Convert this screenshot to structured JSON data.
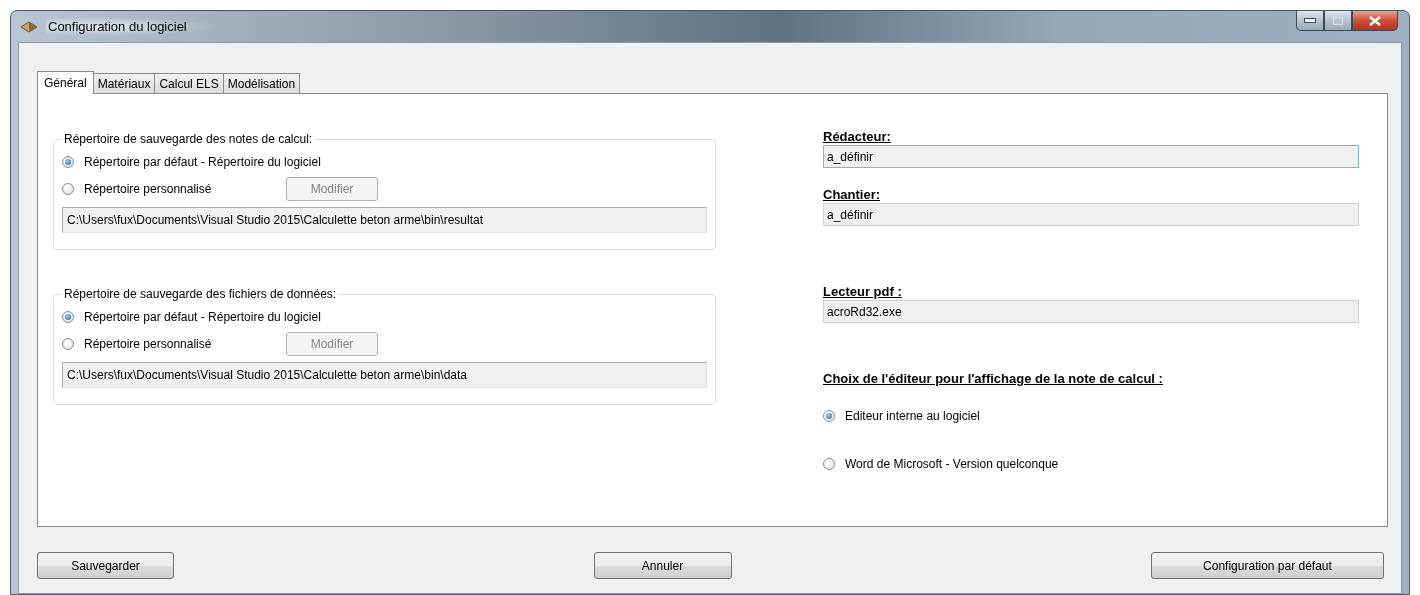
{
  "window": {
    "title": "Configuration du logiciel"
  },
  "tabs": [
    {
      "label": "Général",
      "selected": true
    },
    {
      "label": "Matériaux",
      "selected": false
    },
    {
      "label": "Calcul ELS",
      "selected": false
    },
    {
      "label": "Modélisation",
      "selected": false
    }
  ],
  "groups": [
    {
      "title": "Répertoire de sauvegarde des notes de calcul:",
      "options": [
        {
          "label": "Répertoire par défaut - Répertoire du logiciel",
          "selected": true
        },
        {
          "label": "Répertoire personnalisé",
          "selected": false
        }
      ],
      "modify_button": {
        "label": "Modifier",
        "disabled": true
      },
      "path": "C:\\Users\\fux\\Documents\\Visual Studio 2015\\Calculette beton arme\\bin\\resultat"
    },
    {
      "title": "Répertoire de sauvegarde des fichiers de données:",
      "options": [
        {
          "label": "Répertoire par défaut - Répertoire du logiciel",
          "selected": true
        },
        {
          "label": "Répertoire personnalisé",
          "selected": false
        }
      ],
      "modify_button": {
        "label": "Modifier",
        "disabled": true
      },
      "path": "C:\\Users\\fux\\Documents\\Visual Studio 2015\\Calculette beton arme\\bin\\data"
    }
  ],
  "fields": [
    {
      "label": "Rédacteur:",
      "value": "a_définir",
      "focused": true
    },
    {
      "label": "Chantier:",
      "value": "a_définir",
      "focused": false
    },
    {
      "label": "Lecteur pdf :",
      "value": "acroRd32.exe",
      "focused": false
    }
  ],
  "editor_choice": {
    "title": "Choix de l'éditeur pour l'affichage de la note de calcul :",
    "options": [
      {
        "label": "Editeur interne au logiciel",
        "selected": true
      },
      {
        "label": "Word de Microsoft - Version quelconque",
        "selected": false
      }
    ]
  },
  "buttons": [
    "Sauvegarder",
    "Annuler",
    "Configuration par défaut"
  ]
}
